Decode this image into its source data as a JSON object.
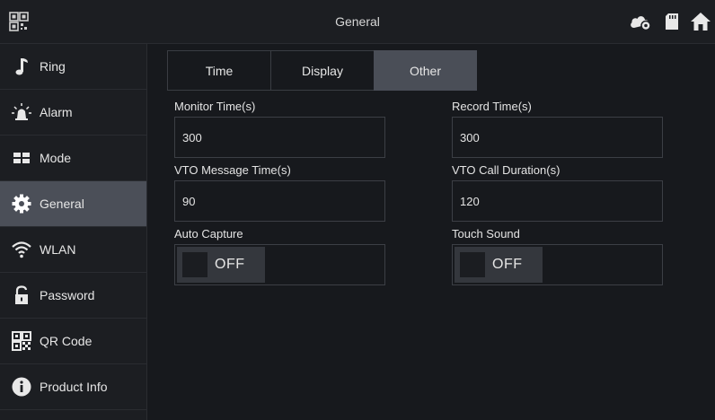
{
  "header": {
    "title": "General",
    "icons": [
      "app-logo-icon",
      "cloud-icon",
      "sd-card-icon",
      "home-icon"
    ]
  },
  "sidebar": {
    "items": [
      {
        "label": "Ring",
        "icon": "music-note-icon",
        "active": false
      },
      {
        "label": "Alarm",
        "icon": "alarm-icon",
        "active": false
      },
      {
        "label": "Mode",
        "icon": "mode-icon",
        "active": false
      },
      {
        "label": "General",
        "icon": "gear-icon",
        "active": true
      },
      {
        "label": "WLAN",
        "icon": "wifi-icon",
        "active": false
      },
      {
        "label": "Password",
        "icon": "lock-icon",
        "active": false
      },
      {
        "label": "QR Code",
        "icon": "qr-code-icon",
        "active": false
      },
      {
        "label": "Product Info",
        "icon": "info-icon",
        "active": false
      }
    ]
  },
  "tabs": [
    {
      "label": "Time",
      "active": false
    },
    {
      "label": "Display",
      "active": false
    },
    {
      "label": "Other",
      "active": true
    }
  ],
  "form": {
    "monitor_time": {
      "label": "Monitor Time(s)",
      "value": "300"
    },
    "record_time": {
      "label": "Record Time(s)",
      "value": "300"
    },
    "vto_message_time": {
      "label": "VTO Message Time(s)",
      "value": "90"
    },
    "vto_call_duration": {
      "label": "VTO Call Duration(s)",
      "value": "120"
    },
    "auto_capture": {
      "label": "Auto Capture",
      "state": "OFF"
    },
    "touch_sound": {
      "label": "Touch Sound",
      "state": "OFF"
    }
  },
  "colors": {
    "background": "#17191d",
    "panel": "#1c1e22",
    "active_item": "#4b4f58",
    "border": "#3c3f45",
    "text": "#e6e6e6"
  }
}
